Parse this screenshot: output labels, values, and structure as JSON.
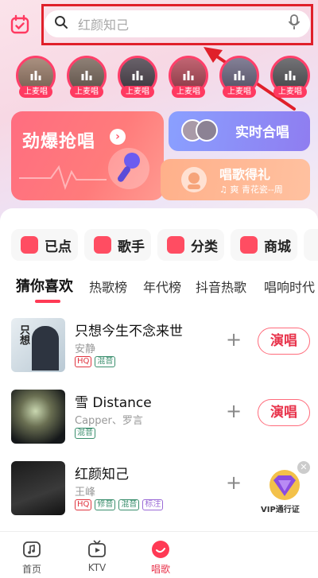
{
  "search": {
    "placeholder": "红颜知己"
  },
  "singers": [
    {
      "tag": "上麦唱"
    },
    {
      "tag": "上麦唱"
    },
    {
      "tag": "上麦唱"
    },
    {
      "tag": "上麦唱"
    },
    {
      "tag": "上麦唱"
    },
    {
      "tag": "上麦唱"
    }
  ],
  "cards": {
    "hot_grab": "劲爆抢唱",
    "realtime_chorus": "实时合唱",
    "sing_gift": {
      "title": "唱歌得礼",
      "sub": "♫ 爽    青花瓷--周"
    }
  },
  "categories": [
    "已点",
    "歌手",
    "分类",
    "商城"
  ],
  "tabs": [
    "猜你喜欢",
    "热歌榜",
    "年代榜",
    "抖音热歌",
    "唱响时代"
  ],
  "songs": [
    {
      "name": "只想今生不念来世",
      "artist": "安静",
      "badges": [
        "HQ",
        "混音"
      ],
      "action": "演唱",
      "cover_text": "只想"
    },
    {
      "name": "雪 Distance",
      "artist": "Capper、罗言",
      "badges": [
        "混音"
      ],
      "action": "演唱"
    },
    {
      "name": "红颜知己",
      "artist": "王峰",
      "badges": [
        "HQ",
        "修音",
        "混音",
        "标注"
      ]
    }
  ],
  "vip": {
    "label": "VIP通行证"
  },
  "nav": [
    {
      "label": "首页"
    },
    {
      "label": "KTV"
    },
    {
      "label": "唱歌"
    }
  ],
  "colors": {
    "accent": "#ff3a55",
    "annotation": "#e0202a"
  }
}
